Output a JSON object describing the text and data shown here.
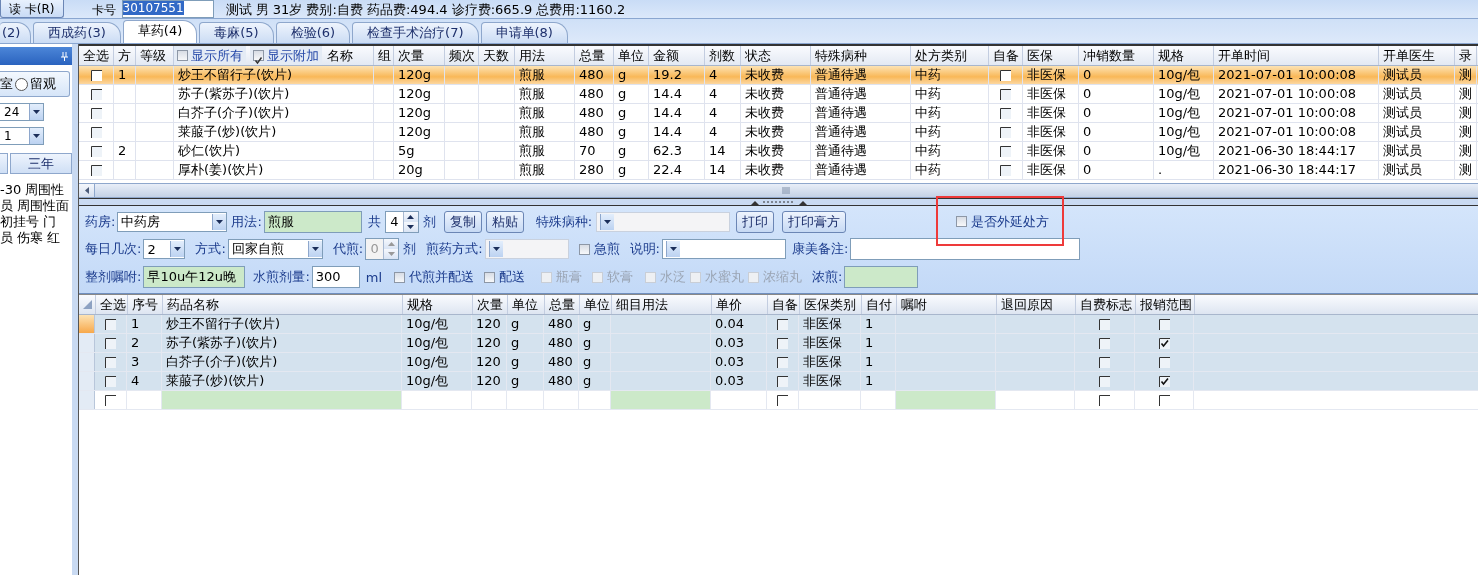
{
  "patient_bar": {
    "read_card_button": "读 卡(R)",
    "card_label": "卡号",
    "card_number": "30107551",
    "info": "测试 男 31岁 费别:自费 药品费:494.4 诊疗费:665.9 总费用:1160.2"
  },
  "tabs": [
    {
      "label": "(2)",
      "selected": false
    },
    {
      "label": "西成药(3)",
      "selected": false
    },
    {
      "label": "草药(4)",
      "selected": true
    },
    {
      "label": "毒麻(5)",
      "selected": false
    },
    {
      "label": "检验(6)",
      "selected": false
    },
    {
      "label": "检查手术治疗(7)",
      "selected": false
    },
    {
      "label": "申请单(8)",
      "selected": false
    }
  ],
  "sidebar": {
    "cut_label": "室",
    "radio": {
      "label": "留观",
      "selected": false
    },
    "selects": [
      "24",
      "1"
    ],
    "button": "三年",
    "lines": [
      "-30 周围性",
      "员 周围性面",
      "初挂号 门",
      "员 伤寒 红"
    ]
  },
  "prescription_grid": {
    "header_options": [
      {
        "label": "显示所有",
        "checked": false
      },
      {
        "label": "显示附加",
        "checked": true
      }
    ],
    "columns": [
      {
        "label": "全选",
        "kind": "check"
      },
      {
        "label": "方",
        "kind": "text"
      },
      {
        "label": "等级",
        "kind": "text"
      },
      {
        "label": "名称",
        "kind": "text"
      },
      {
        "label": "组",
        "kind": "text"
      },
      {
        "label": "次量",
        "kind": "text"
      },
      {
        "label": "频次",
        "kind": "text"
      },
      {
        "label": "天数",
        "kind": "text"
      },
      {
        "label": "用法",
        "kind": "text"
      },
      {
        "label": "总量",
        "kind": "text"
      },
      {
        "label": "单位",
        "kind": "text"
      },
      {
        "label": "金额",
        "kind": "text"
      },
      {
        "label": "剂数",
        "kind": "text"
      },
      {
        "label": "状态",
        "kind": "text"
      },
      {
        "label": "特殊病种",
        "kind": "text"
      },
      {
        "label": "处方类别",
        "kind": "text"
      },
      {
        "label": "自备",
        "kind": "check"
      },
      {
        "label": "医保",
        "kind": "text"
      },
      {
        "label": "冲销数量",
        "kind": "text"
      },
      {
        "label": "规格",
        "kind": "text"
      },
      {
        "label": "开单时间",
        "kind": "text"
      },
      {
        "label": "开单医生",
        "kind": "text"
      },
      {
        "label": "录",
        "kind": "text"
      }
    ],
    "rows": [
      {
        "selected": true,
        "cells": [
          false,
          "1",
          "",
          "炒王不留行子(饮片)",
          "",
          "120g",
          "",
          "",
          "煎服",
          "480",
          "g",
          "19.2",
          "4",
          "未收费",
          "普通待遇",
          "中药",
          false,
          "非医保",
          "0",
          "10g/包",
          "2021-07-01 10:00:08",
          "测试员",
          "测"
        ]
      },
      {
        "selected": false,
        "cells": [
          false,
          "",
          "",
          "苏子(紫苏子)(饮片)",
          "",
          "120g",
          "",
          "",
          "煎服",
          "480",
          "g",
          "14.4",
          "4",
          "未收费",
          "普通待遇",
          "中药",
          false,
          "非医保",
          "0",
          "10g/包",
          "2021-07-01 10:00:08",
          "测试员",
          "测"
        ]
      },
      {
        "selected": false,
        "cells": [
          false,
          "",
          "",
          "白芥子(介子)(饮片)",
          "",
          "120g",
          "",
          "",
          "煎服",
          "480",
          "g",
          "14.4",
          "4",
          "未收费",
          "普通待遇",
          "中药",
          false,
          "非医保",
          "0",
          "10g/包",
          "2021-07-01 10:00:08",
          "测试员",
          "测"
        ]
      },
      {
        "selected": false,
        "cells": [
          false,
          "",
          "",
          "莱菔子(炒)(饮片)",
          "",
          "120g",
          "",
          "",
          "煎服",
          "480",
          "g",
          "14.4",
          "4",
          "未收费",
          "普通待遇",
          "中药",
          false,
          "非医保",
          "0",
          "10g/包",
          "2021-07-01 10:00:08",
          "测试员",
          "测"
        ]
      },
      {
        "selected": false,
        "cells": [
          false,
          "2",
          "",
          "砂仁(饮片)",
          "",
          "5g",
          "",
          "",
          "煎服",
          "70",
          "g",
          "62.3",
          "14",
          "未收费",
          "普通待遇",
          "中药",
          false,
          "非医保",
          "0",
          "10g/包",
          "2021-06-30 18:44:17",
          "测试员",
          "测"
        ]
      },
      {
        "selected": false,
        "cells": [
          false,
          "",
          "",
          "厚朴(姜)(饮片)",
          "",
          "20g",
          "",
          "",
          "煎服",
          "280",
          "g",
          "22.4",
          "14",
          "未收费",
          "普通待遇",
          "中药",
          false,
          "非医保",
          "0",
          ".",
          "2021-06-30 18:44:17",
          "测试员",
          "测"
        ]
      }
    ]
  },
  "form": {
    "rows": [
      {
        "items": [
          {
            "kind": "label",
            "text": "药房:"
          },
          {
            "kind": "select",
            "value": "中药房",
            "disabled": false
          },
          {
            "kind": "label",
            "text": "用法:"
          },
          {
            "kind": "field",
            "value": "煎服",
            "required": true
          },
          {
            "kind": "label",
            "text": "共"
          },
          {
            "kind": "spin",
            "value": "4",
            "disabled": false
          },
          {
            "kind": "label",
            "text": "剂"
          },
          {
            "kind": "button",
            "text": "复制"
          },
          {
            "kind": "button",
            "text": "粘贴"
          },
          {
            "kind": "label",
            "text": "特殊病种:"
          },
          {
            "kind": "select",
            "disabled": true
          },
          {
            "kind": "button",
            "text": "打印"
          },
          {
            "kind": "button",
            "text": "打印膏方"
          },
          {
            "kind": "checkbox",
            "text": "是否外延处方",
            "checked": false,
            "disabled": false,
            "outlined": true
          }
        ]
      },
      {
        "items": [
          {
            "kind": "label",
            "text": "每日几次:"
          },
          {
            "kind": "select",
            "value": "2",
            "disabled": false
          },
          {
            "kind": "label",
            "text": "方式:"
          },
          {
            "kind": "select",
            "value": "回家自煎",
            "disabled": false
          },
          {
            "kind": "label",
            "text": "代煎:"
          },
          {
            "kind": "spin",
            "value": "0",
            "disabled": true
          },
          {
            "kind": "label",
            "text": "剂"
          },
          {
            "kind": "label",
            "text": "煎药方式:"
          },
          {
            "kind": "select",
            "disabled": true
          },
          {
            "kind": "checkbox",
            "text": "急煎",
            "checked": false,
            "disabled": false
          },
          {
            "kind": "label",
            "text": "说明:"
          },
          {
            "kind": "select",
            "disabled": false
          },
          {
            "kind": "label",
            "text": "康美备注:"
          },
          {
            "kind": "field",
            "required": false
          }
        ]
      },
      {
        "items": [
          {
            "kind": "label",
            "text": "整剂嘱咐:"
          },
          {
            "kind": "field",
            "value": "早10u午12u晚",
            "required": true
          },
          {
            "kind": "label",
            "text": "水煎剂量:"
          },
          {
            "kind": "field",
            "value": "300",
            "required": false
          },
          {
            "kind": "label",
            "text": "ml"
          },
          {
            "kind": "checkbox",
            "text": "代煎并配送",
            "checked": false,
            "disabled": false
          },
          {
            "kind": "checkbox",
            "text": "配送",
            "checked": false,
            "disabled": false
          },
          {
            "kind": "checkbox",
            "text": "瓶膏",
            "checked": false,
            "disabled": true
          },
          {
            "kind": "checkbox",
            "text": "软膏",
            "checked": false,
            "disabled": true
          },
          {
            "kind": "checkbox",
            "text": "水泛",
            "checked": false,
            "disabled": true
          },
          {
            "kind": "checkbox",
            "text": "水蜜丸",
            "checked": false,
            "disabled": true
          },
          {
            "kind": "checkbox",
            "text": "浓缩丸",
            "checked": false,
            "disabled": true
          },
          {
            "kind": "label",
            "text": "浓煎:"
          },
          {
            "kind": "field",
            "required": true
          }
        ]
      }
    ]
  },
  "detail_grid": {
    "columns": [
      {
        "label": "全选",
        "kind": "check"
      },
      {
        "label": "序号",
        "kind": "text"
      },
      {
        "label": "药品名称",
        "kind": "entry"
      },
      {
        "label": "规格",
        "kind": "text"
      },
      {
        "label": "次量",
        "kind": "text"
      },
      {
        "label": "单位",
        "kind": "text"
      },
      {
        "label": "总量",
        "kind": "text"
      },
      {
        "label": "单位",
        "kind": "text"
      },
      {
        "label": "细目用法",
        "kind": "entry"
      },
      {
        "label": "单价",
        "kind": "text"
      },
      {
        "label": "自备",
        "kind": "check"
      },
      {
        "label": "医保类别",
        "kind": "text"
      },
      {
        "label": "自付",
        "kind": "text"
      },
      {
        "label": "嘱咐",
        "kind": "entry"
      },
      {
        "label": "退回原因",
        "kind": "text"
      },
      {
        "label": "自费标志",
        "kind": "check"
      },
      {
        "label": "报销范围",
        "kind": "check"
      }
    ],
    "rows": [
      {
        "kind": "item",
        "selected": true,
        "cells": [
          false,
          "1",
          "炒王不留行子(饮片)",
          "10g/包",
          "120",
          "g",
          "480",
          "g",
          "",
          "0.04",
          false,
          "非医保",
          "1",
          "",
          "",
          false,
          false
        ]
      },
      {
        "kind": "item",
        "selected": false,
        "cells": [
          false,
          "2",
          "苏子(紫苏子)(饮片)",
          "10g/包",
          "120",
          "g",
          "480",
          "g",
          "",
          "0.03",
          false,
          "非医保",
          "1",
          "",
          "",
          false,
          true
        ]
      },
      {
        "kind": "item",
        "selected": false,
        "cells": [
          false,
          "3",
          "白芥子(介子)(饮片)",
          "10g/包",
          "120",
          "g",
          "480",
          "g",
          "",
          "0.03",
          false,
          "非医保",
          "1",
          "",
          "",
          false,
          false
        ]
      },
      {
        "kind": "item",
        "selected": false,
        "cells": [
          false,
          "4",
          "莱菔子(炒)(饮片)",
          "10g/包",
          "120",
          "g",
          "480",
          "g",
          "",
          "0.03",
          false,
          "非医保",
          "1",
          "",
          "",
          false,
          true
        ]
      },
      {
        "kind": "blank",
        "selected": false,
        "cells": [
          false,
          "",
          "",
          "",
          "",
          "",
          "",
          "",
          "",
          "",
          false,
          "",
          "",
          "",
          "",
          false,
          false
        ]
      }
    ]
  }
}
